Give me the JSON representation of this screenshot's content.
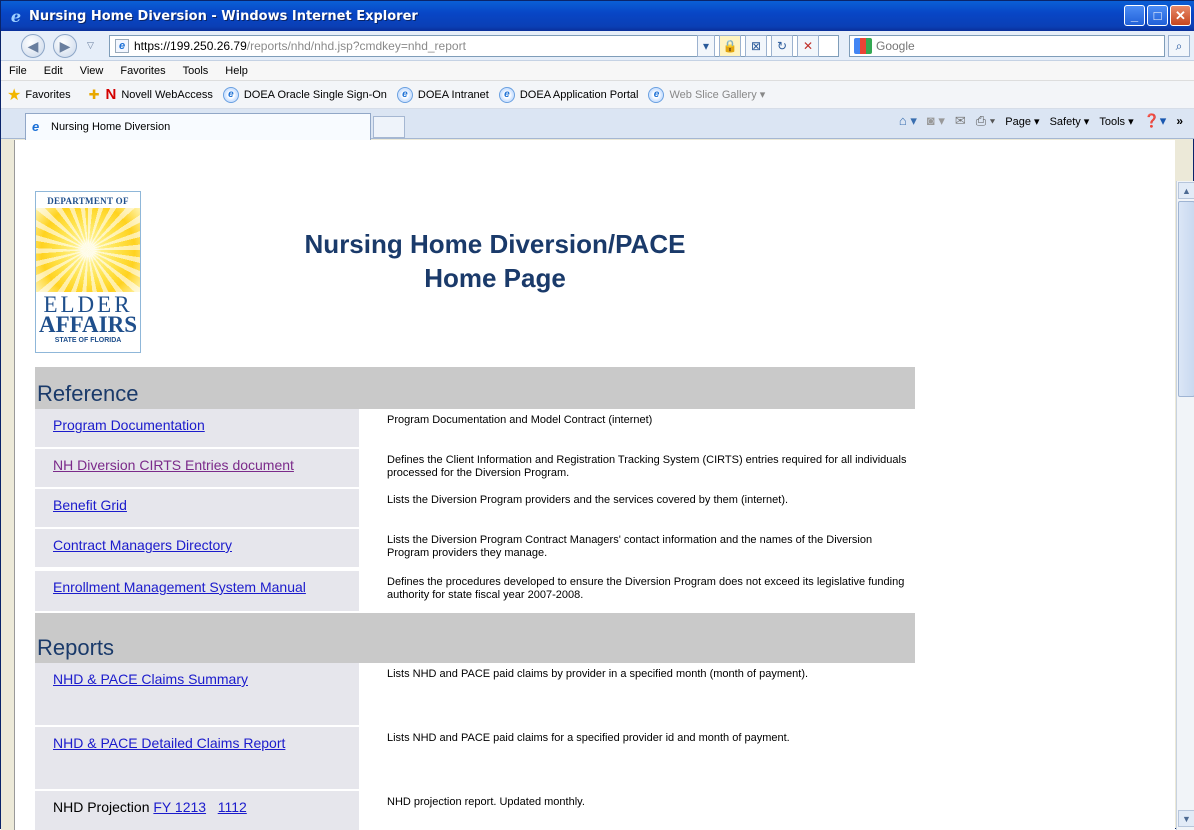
{
  "window": {
    "title": "Nursing Home Diversion - Windows Internet Explorer",
    "min_symbol": "_",
    "max_symbol": "□",
    "close_symbol": "✕"
  },
  "address": {
    "url_host": "https://199.250.26.79",
    "url_path": "/reports/nhd/nhd.jsp?cmdkey=nhd_report",
    "search_placeholder": "Google"
  },
  "menu": [
    "File",
    "Edit",
    "View",
    "Favorites",
    "Tools",
    "Help"
  ],
  "favorites": {
    "label": "Favorites",
    "items": [
      {
        "label": "Novell WebAccess",
        "icon": "novell-icon"
      },
      {
        "label": "DOEA Oracle Single Sign-On",
        "icon": "ie-page-icon"
      },
      {
        "label": "DOEA Intranet",
        "icon": "ie-page-icon"
      },
      {
        "label": "DOEA Application Portal",
        "icon": "ie-page-icon"
      },
      {
        "label": "Web Slice Gallery ▾",
        "icon": "ie-page-icon"
      }
    ]
  },
  "tab": {
    "label": "Nursing Home Diversion"
  },
  "commandbar": {
    "page": "Page ▾",
    "safety": "Safety ▾",
    "tools": "Tools ▾"
  },
  "logo": {
    "dept": "DEPARTMENT OF",
    "elder": "ELDER",
    "affairs": "AFFAIRS",
    "state": "STATE OF FLORIDA"
  },
  "page": {
    "title_line1": "Nursing Home Diversion/PACE",
    "title_line2": "Home Page"
  },
  "reference": {
    "header": "Reference",
    "rows": [
      {
        "link": "Program Documentation",
        "desc": "Program Documentation and Model Contract (internet)"
      },
      {
        "link": "NH Diversion CIRTS Entries document",
        "desc": "Defines the Client Information and Registration Tracking System (CIRTS) entries required for all individuals processed for the Diversion Program."
      },
      {
        "link": "Benefit Grid",
        "desc": "Lists the Diversion Program providers and the services covered by them (internet)."
      },
      {
        "link": "Contract Managers Directory",
        "desc": "Lists the Diversion Program Contract Managers' contact information and the names of the Diversion Program providers they manage."
      },
      {
        "link": "Enrollment Management System Manual",
        "desc": "Defines the procedures developed to ensure the Diversion Program does not exceed its legislative funding authority for state fiscal year 2007-2008."
      }
    ]
  },
  "reports": {
    "header": "Reports",
    "rows": [
      {
        "link": "NHD & PACE Claims Summary",
        "desc": "Lists NHD and PACE paid claims by provider in a specified month (month of payment)."
      },
      {
        "link": "NHD & PACE Detailed Claims Report",
        "desc": "Lists NHD and PACE paid claims for a specified provider id and month of payment."
      }
    ],
    "projection": {
      "label": "NHD Projection",
      "link1": "FY 1213",
      "link2": "1112",
      "desc": "NHD projection report. Updated monthly."
    }
  }
}
